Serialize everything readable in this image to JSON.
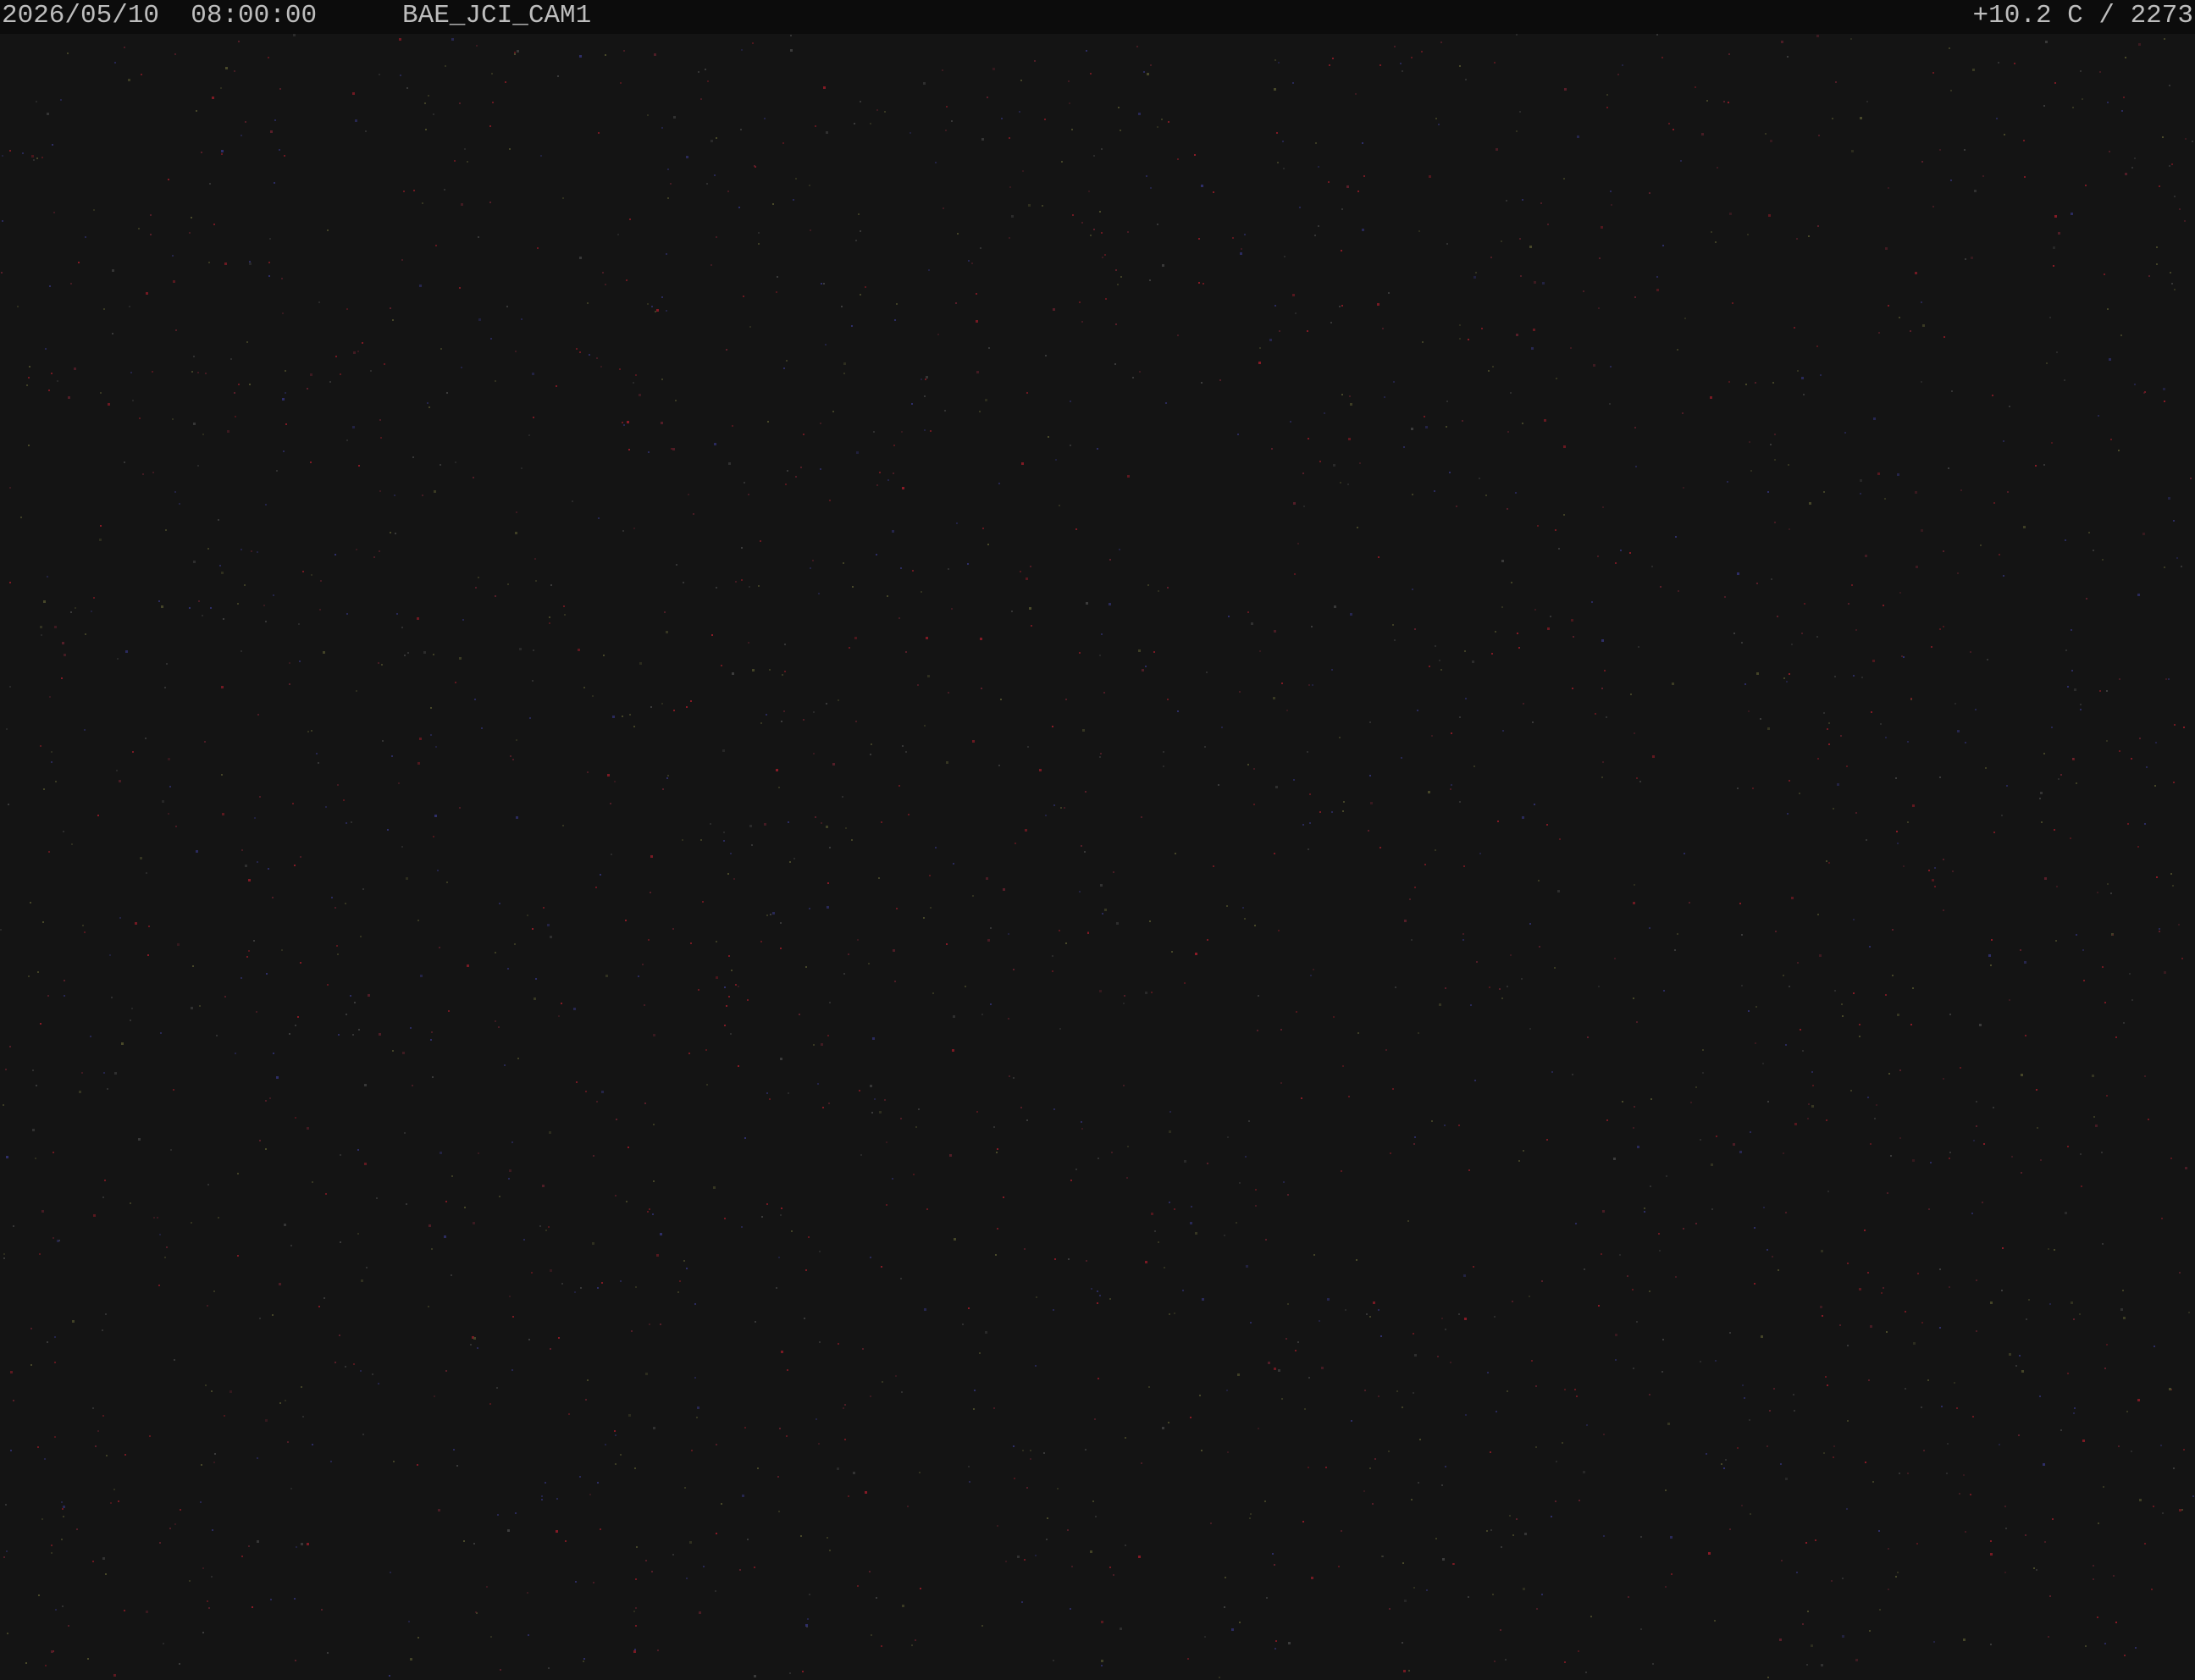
{
  "overlay": {
    "timestamp": "2026/05/10  08:00:00",
    "camera_id": "BAE_JCI_CAM1",
    "sensor_readout": "+10.2 C / 2273"
  },
  "frame": {
    "background_color": "#141414",
    "overlay_background": "#0c0c0c",
    "overlay_text_color": "#bdbdbd",
    "noise_colors": [
      "#8a1b26",
      "#5a1f2a",
      "#2f2f6a",
      "#3d3d3d",
      "#4a4a2a"
    ]
  }
}
